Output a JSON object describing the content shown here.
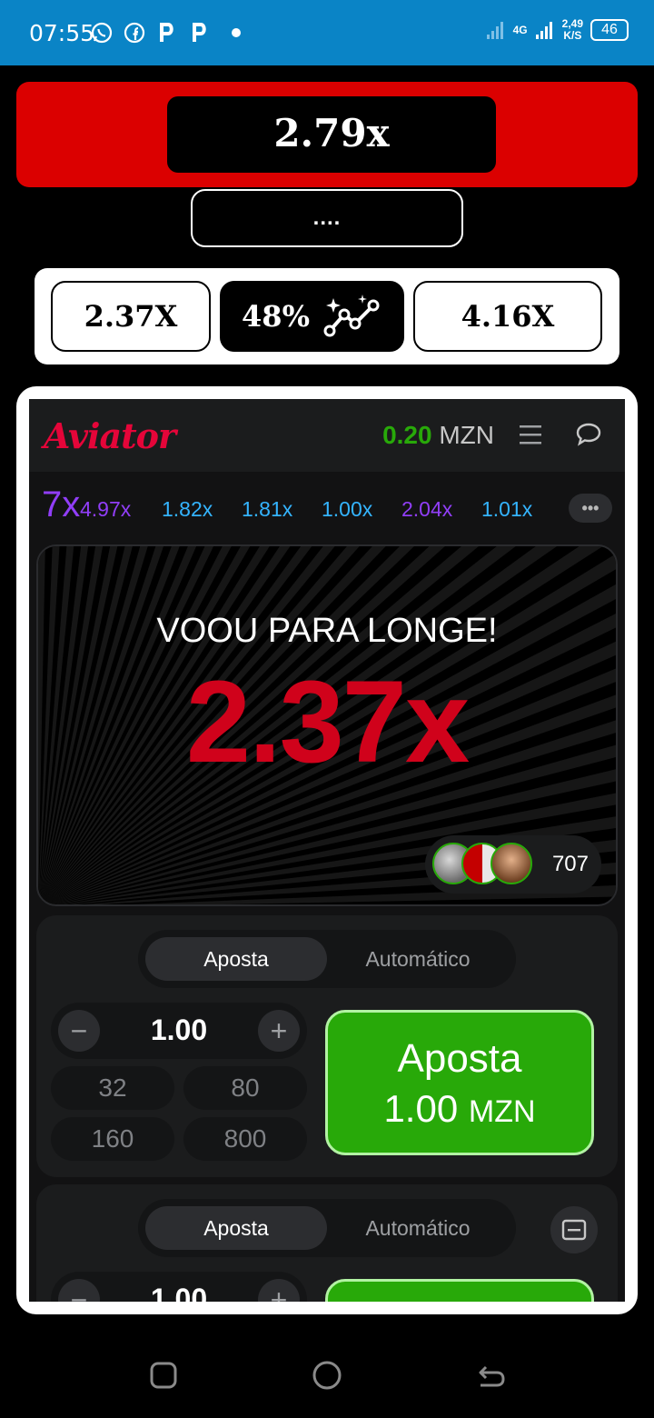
{
  "status_bar": {
    "time": "07:55",
    "network": "4G",
    "speed": "2,49",
    "speed_unit": "K/S",
    "battery": "46",
    "app_icons": [
      "whatsapp-icon",
      "facebook-icon",
      "p-app-icon",
      "p-app-icon"
    ]
  },
  "predictor": {
    "multiplier": "2.79x",
    "menu_dots": "....",
    "stat_left": "2.37X",
    "stat_percent": "48%",
    "stat_right": "4.16X"
  },
  "game": {
    "logo": "Aviator",
    "balance_amount": "0.20",
    "balance_currency": "MZN",
    "history": {
      "partial_first": "7x",
      "items": [
        {
          "value": "4.97x",
          "color": "#913ef8"
        },
        {
          "value": "1.82x",
          "color": "#34b4ff"
        },
        {
          "value": "1.81x",
          "color": "#34b4ff"
        },
        {
          "value": "1.00x",
          "color": "#34b4ff"
        },
        {
          "value": "2.04x",
          "color": "#913ef8"
        },
        {
          "value": "1.01x",
          "color": "#34b4ff"
        }
      ],
      "more": "•••"
    },
    "round": {
      "message": "VOOU PARA LONGE!",
      "result": "2.37x",
      "players_count": "707"
    },
    "bet_panel_1": {
      "tab_active": "Aposta",
      "tab_inactive": "Automático",
      "amount": "1.00",
      "minus": "−",
      "plus": "+",
      "quick_amounts": [
        "32",
        "80",
        "160",
        "800"
      ],
      "button_title": "Aposta",
      "button_amount": "1.00",
      "button_currency": "MZN"
    },
    "bet_panel_2": {
      "tab_active": "Aposta",
      "tab_inactive": "Automático",
      "amount": "1.00",
      "minus": "−",
      "plus": "+"
    }
  },
  "colors": {
    "accent_red": "#e50539",
    "win_green": "#28a909",
    "status_blue": "#0a84c6",
    "predictor_red": "#db0000"
  }
}
